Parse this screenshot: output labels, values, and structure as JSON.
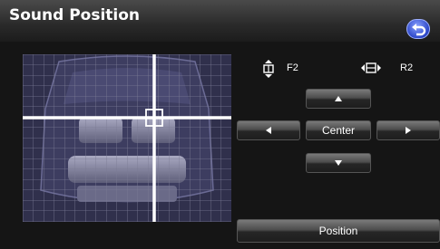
{
  "header": {
    "title": "Sound Position"
  },
  "indicators": {
    "front_rear_value": "F2",
    "left_right_value": "R2"
  },
  "controls": {
    "center_label": "Center",
    "position_label": "Position"
  }
}
